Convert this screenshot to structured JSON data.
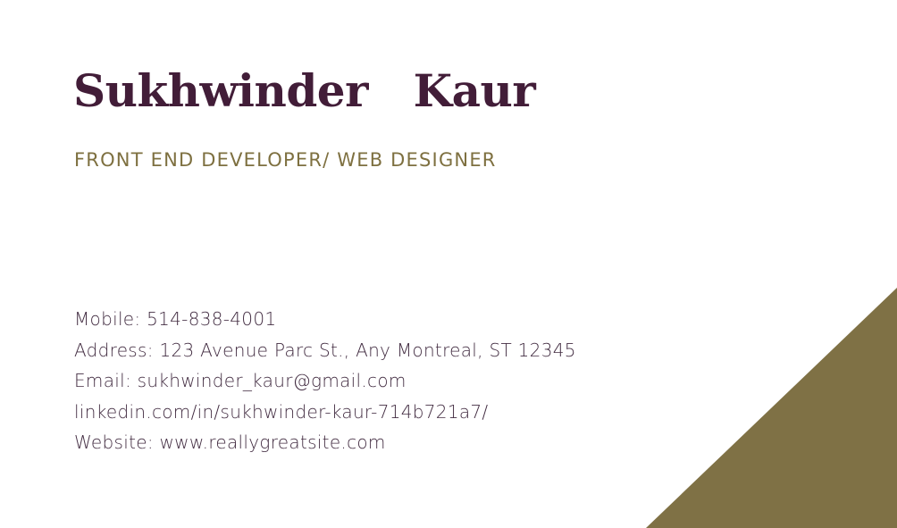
{
  "card": {
    "name": "Sukhwinder   Kaur",
    "job_title": "FRONT END DEVELOPER/ WEB DESIGNER",
    "contacts": {
      "mobile": "Mobile: 514-838-4001",
      "address": "Address: 123 Avenue Parc St., Any  Montreal, ST 12345",
      "email": "Email: sukhwinder_kaur@gmail.com",
      "linkedin": "linkedin.com/in/sukhwinder-kaur-714b721a7/",
      "website": "Website: www.reallygreatsite.com"
    }
  },
  "colors": {
    "name": "#421d38",
    "title": "#7e7040",
    "text": "#432d42",
    "accent": "#7f7145",
    "background": "#ffffff"
  }
}
